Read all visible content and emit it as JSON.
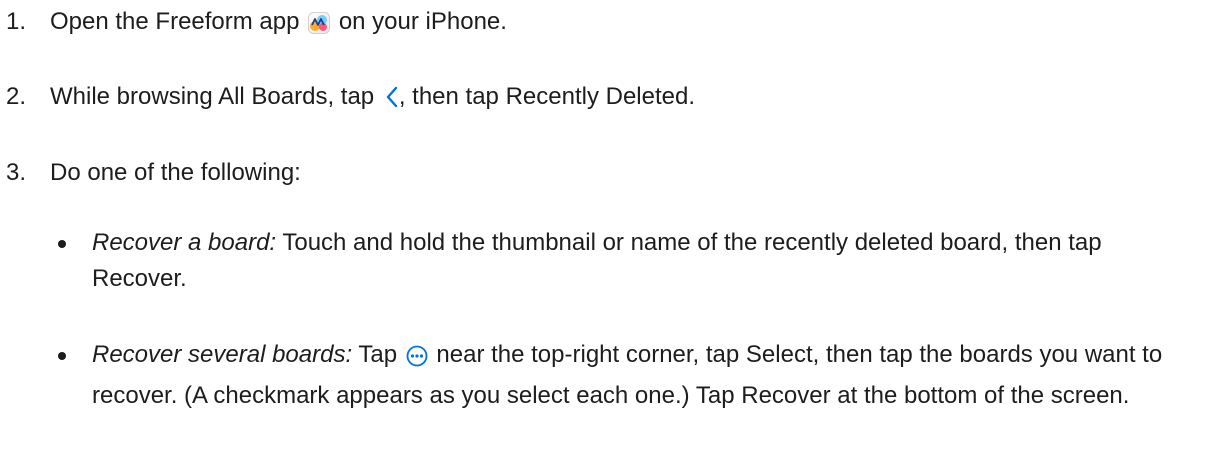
{
  "steps": [
    {
      "number": "1.",
      "before": "Open the Freeform app",
      "after": "on your iPhone."
    },
    {
      "number": "2.",
      "before": "While browsing All Boards, tap",
      "after": ", then tap Recently Deleted."
    },
    {
      "number": "3.",
      "text": "Do one of the following:"
    }
  ],
  "bullets": [
    {
      "title": "Recover a board:",
      "text": "Touch and hold the thumbnail or name of the recently deleted board, then tap Recover."
    },
    {
      "title": "Recover several boards:",
      "before": "Tap",
      "after": "near the top-right corner, tap Select, then tap the boards you want to recover. (A checkmark appears as you select each one.) Tap Recover at the bottom of the screen."
    }
  ],
  "icons": {
    "app": "freeform-app-icon",
    "back": "chevron-left-icon",
    "more": "more-ellipsis-circle-icon"
  },
  "colors": {
    "text": "#1d1d1f",
    "accent": "#0071e3"
  }
}
